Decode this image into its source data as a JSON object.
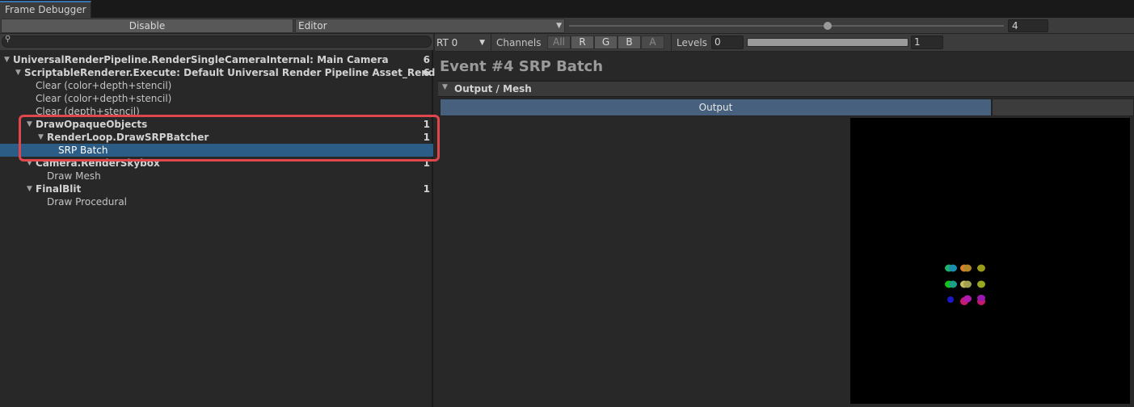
{
  "window": {
    "tab_title": "Frame Debugger"
  },
  "toolbar": {
    "disable_label": "Disable",
    "target_dropdown": "Editor",
    "event_number": "4"
  },
  "tree": {
    "items": [
      {
        "label": "UniversalRenderPipeline.RenderSingleCameraInternal: Main Camera",
        "count": "6"
      },
      {
        "label": "ScriptableRenderer.Execute: Default Universal Render Pipeline Asset_Renderer",
        "count": "6"
      },
      {
        "label": "Clear (color+depth+stencil)"
      },
      {
        "label": "Clear (color+depth+stencil)"
      },
      {
        "label": "Clear (depth+stencil)"
      },
      {
        "label": "DrawOpaqueObjects",
        "count": "1"
      },
      {
        "label": "RenderLoop.DrawSRPBatcher",
        "count": "1"
      },
      {
        "label": "SRP Batch"
      },
      {
        "label": "Camera.RenderSkybox",
        "count": "1"
      },
      {
        "label": "Draw Mesh"
      },
      {
        "label": "FinalBlit",
        "count": "1"
      },
      {
        "label": "Draw Procedural"
      }
    ]
  },
  "right_toolbar": {
    "rt_dropdown": "RT 0",
    "channels_label": "Channels",
    "channels": [
      "All",
      "R",
      "G",
      "B",
      "A"
    ],
    "levels_label": "Levels",
    "levels_min": "0",
    "levels_max": "1"
  },
  "event": {
    "title": "Event #4 SRP Batch",
    "section_label": "Output / Mesh",
    "output_tab": "Output"
  },
  "colors": {
    "selection": "#2c5d87",
    "highlight_border": "#e0474c",
    "output_tab": "#46607e"
  }
}
